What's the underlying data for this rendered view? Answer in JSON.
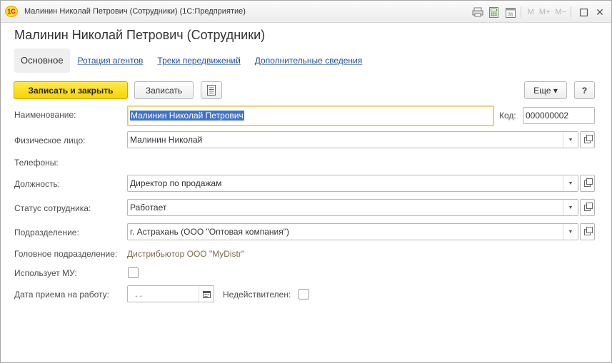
{
  "window": {
    "logo_text": "1С",
    "title": "Малинин Николай Петрович (Сотрудники) (1С:Предприятие)",
    "tools": {
      "m_label": "M",
      "m_plus_label": "M+",
      "m_minus_label": "M−",
      "calendar_day": "31"
    }
  },
  "header": {
    "title": "Малинин Николай Петрович (Сотрудники)"
  },
  "tabs": [
    {
      "label": "Основное",
      "active": true
    },
    {
      "label": "Ротация агентов",
      "active": false
    },
    {
      "label": "Треки передвижений",
      "active": false
    },
    {
      "label": "Дополнительные сведения",
      "active": false
    }
  ],
  "toolbar": {
    "save_close_label": "Записать и закрыть",
    "save_label": "Записать",
    "more_label": "Еще ▾",
    "help_label": "?"
  },
  "form": {
    "name_label": "Наименование:",
    "name_value": "Малинин Николай Петрович",
    "code_label": "Код:",
    "code_value": "000000002",
    "person_label": "Физическое лицо:",
    "person_value": "Малинин Николай",
    "phones_label": "Телефоны:",
    "position_label": "Должность:",
    "position_value": "Директор по продажам",
    "status_label": "Статус сотрудника:",
    "status_value": "Работает",
    "division_label": "Подразделение:",
    "division_value": "г. Астрахань (ООО \"Оптовая компания\")",
    "head_division_label": "Головное подразделение:",
    "head_division_value": "Дистрибьютор ООО \"MyDistr\"",
    "uses_mu_label": "Использует МУ:",
    "uses_mu_checked": false,
    "hire_date_label": "Дата приема на работу:",
    "hire_date_value": " .  .",
    "invalid_label": "Недействителен:",
    "invalid_checked": false
  }
}
